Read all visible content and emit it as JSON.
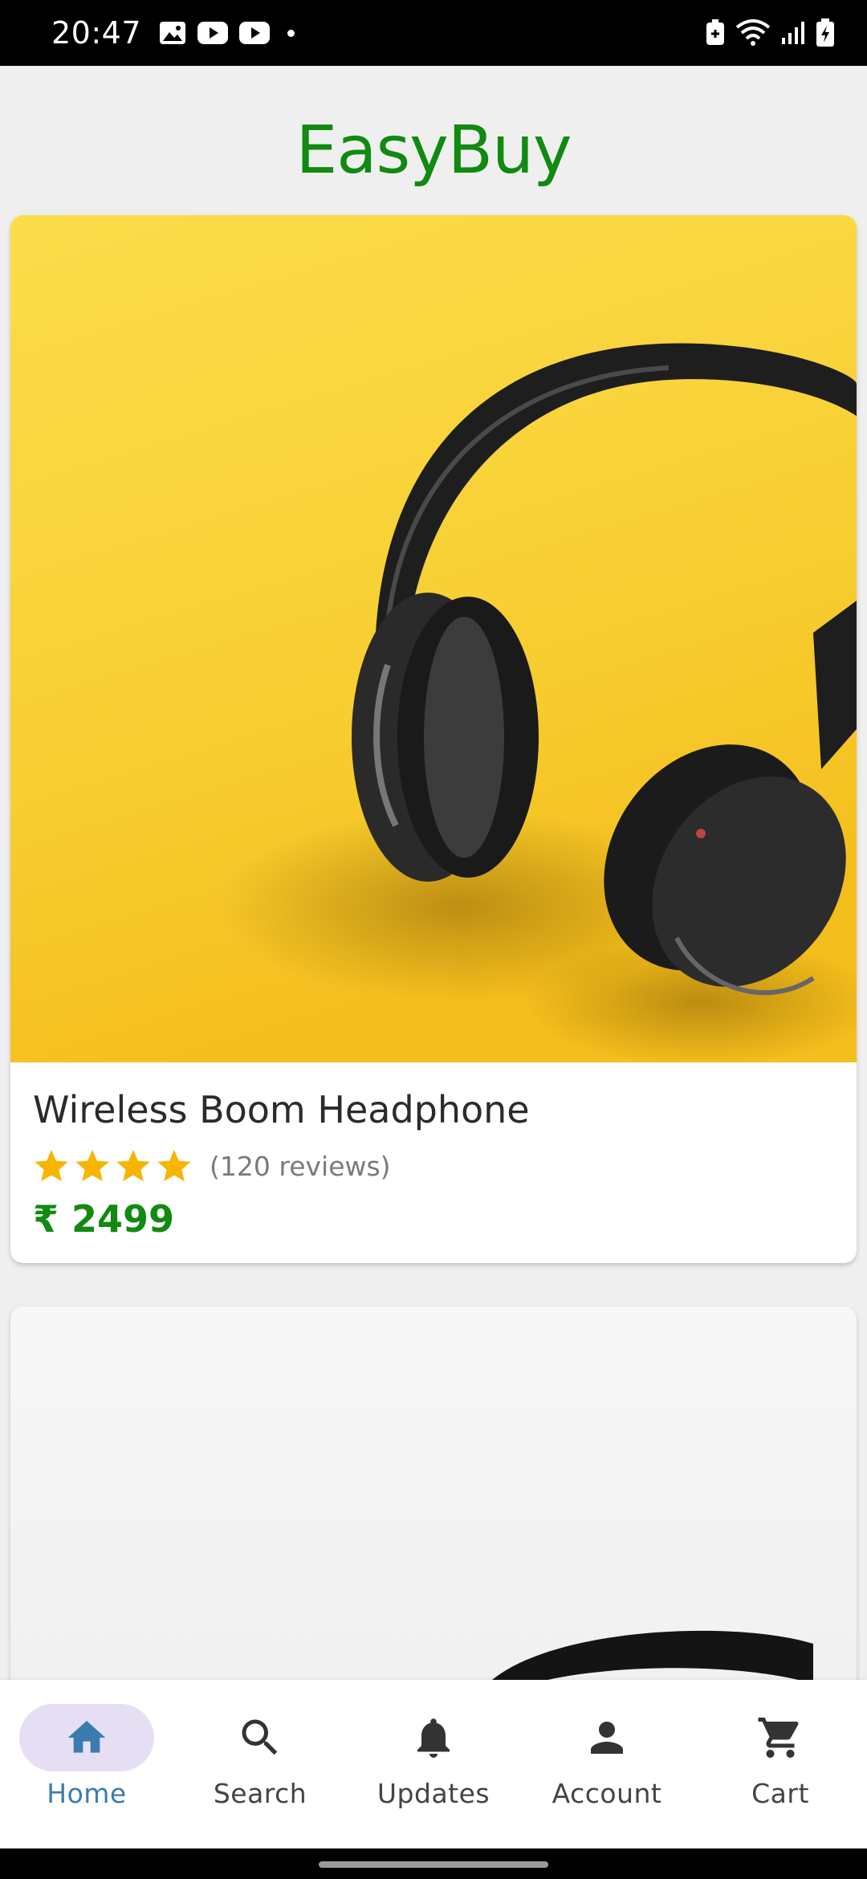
{
  "status_bar": {
    "time": "20:47"
  },
  "app": {
    "title": "EasyBuy"
  },
  "products": [
    {
      "name": "Wireless Boom Headphone",
      "rating": 4,
      "max_rating": 5,
      "reviews": "(120 reviews)",
      "price": "₹ 2499",
      "image_icon": "headphone-photo"
    }
  ],
  "bottom_nav": {
    "items": [
      {
        "label": "Home",
        "icon": "home-icon",
        "active": true
      },
      {
        "label": "Search",
        "icon": "search-icon",
        "active": false
      },
      {
        "label": "Updates",
        "icon": "bell-icon",
        "active": false
      },
      {
        "label": "Account",
        "icon": "person-icon",
        "active": false
      },
      {
        "label": "Cart",
        "icon": "cart-icon",
        "active": false
      }
    ]
  },
  "colors": {
    "brand": "#108a10",
    "active_nav": "#3b7bb0",
    "active_pill": "#e6dff4",
    "star": "#f7b500"
  }
}
